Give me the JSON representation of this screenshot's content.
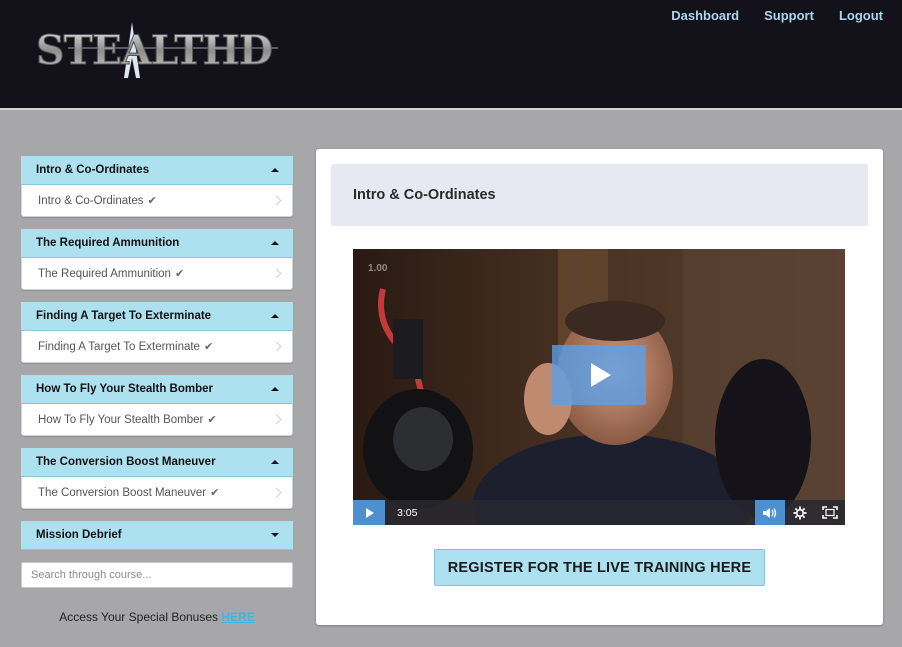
{
  "brand": {
    "logo_text": "STEALTHD"
  },
  "nav": {
    "dashboard": "Dashboard",
    "support": "Support",
    "logout": "Logout"
  },
  "sidebar": {
    "sections": [
      {
        "title": "Intro & Co-Ordinates",
        "expanded": true,
        "item": "Intro & Co-Ordinates",
        "completed": true
      },
      {
        "title": "The Required Ammunition",
        "expanded": true,
        "item": "The Required Ammunition",
        "completed": true
      },
      {
        "title": "Finding A Target To Exterminate",
        "expanded": true,
        "item": "Finding A Target To Exterminate",
        "completed": true
      },
      {
        "title": "How To Fly Your Stealth Bomber",
        "expanded": true,
        "item": "How To Fly Your Stealth Bomber",
        "completed": true
      },
      {
        "title": "The Conversion Boost Maneuver",
        "expanded": true,
        "item": "The Conversion Boost Maneuver",
        "completed": true
      },
      {
        "title": "Mission Debrief",
        "expanded": false
      }
    ],
    "search_placeholder": "Search through course...",
    "bonus_text": "Access Your Special Bonuses ",
    "bonus_link": "HERE"
  },
  "main": {
    "lesson_title": "Intro & Co-Ordinates",
    "video": {
      "speed": "1.00",
      "duration": "3:05"
    },
    "cta_label": "REGISTER FOR THE LIVE TRAINING HERE"
  },
  "colors": {
    "header_bg": "#13111a",
    "accent": "#aee1f0",
    "nav_link": "#a9d6ee",
    "player_blue": "#4d8fcf",
    "page_bg": "#a7a7a9"
  }
}
